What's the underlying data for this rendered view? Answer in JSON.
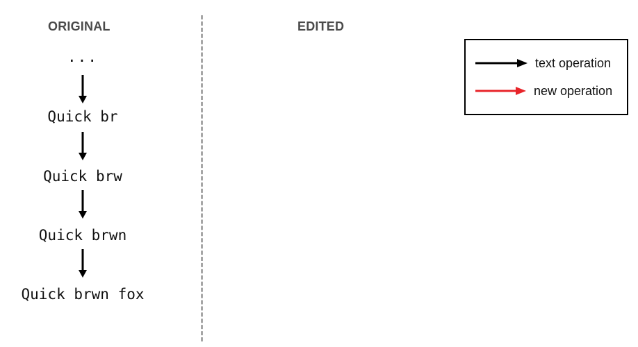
{
  "columns": {
    "original_title": "ORIGINAL",
    "edited_title": "EDITED"
  },
  "original_sequence": {
    "ellipsis": "...",
    "steps": [
      "Quick br",
      "Quick brw",
      "Quick brwn",
      "Quick brwn fox"
    ]
  },
  "legend": {
    "items": [
      {
        "label": "text operation",
        "color": "#000000"
      },
      {
        "label": "new operation",
        "color": "#e8242a"
      }
    ]
  }
}
